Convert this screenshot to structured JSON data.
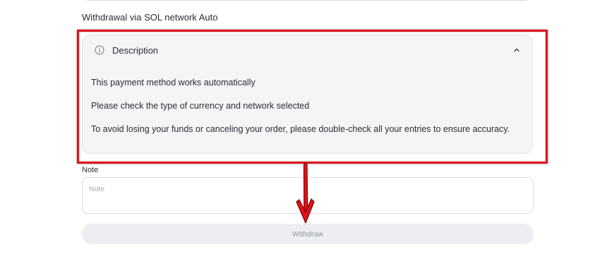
{
  "withdrawal": {
    "method_title": "Withdrawal via SOL network Auto"
  },
  "description": {
    "title": "Description",
    "expanded": true,
    "lines": [
      "This payment method works automatically",
      "Please check the type of currency and network selected",
      "To avoid losing your funds or canceling your order, please double-check all your entries to ensure accuracy."
    ],
    "info_icon": "info-circle-icon",
    "toggle_icon": "chevron-up-icon"
  },
  "note": {
    "label": "Note",
    "placeholder": "Note",
    "value": ""
  },
  "actions": {
    "withdraw_label": "Withdraw"
  },
  "annotation": {
    "highlight_color": "#e0141b",
    "arrow_color": "#e0141b"
  }
}
